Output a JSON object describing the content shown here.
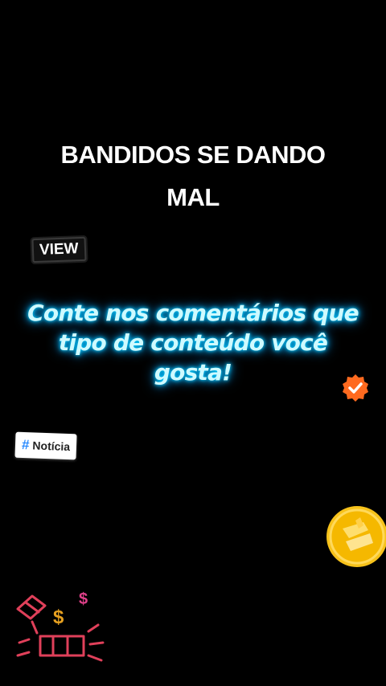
{
  "post": {
    "title": "BANDIDOS SE DANDO MAL",
    "view_badge": "VIEW",
    "cta_text": "Conte nos comentários que tipo de conteúdo você gosta!",
    "tag_label": "Notícia",
    "tag_symbol": "#"
  },
  "icons": {
    "verified": "verified-check-icon",
    "coin": "gold-coin-icon",
    "gift": "gift-box-icon",
    "dollar": "dollar-sign-icon"
  },
  "colors": {
    "background": "#000000",
    "cta_glow": "#00cfff",
    "verified_badge": "#ff6a1f",
    "coin": "#f5b800",
    "gift_stroke": "#e0405a",
    "dollar_pink": "#e0408a",
    "dollar_gold": "#e6a020",
    "tag_hash": "#2a8bff"
  }
}
